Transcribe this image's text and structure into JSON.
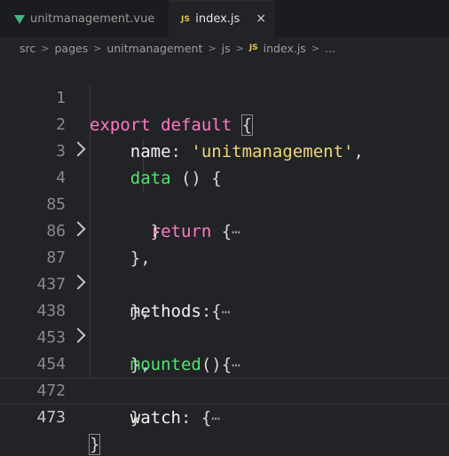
{
  "tabs": [
    {
      "label": "unitmanagement.vue",
      "icon": "vue-icon",
      "active": false
    },
    {
      "label": "index.js",
      "icon": "js-icon",
      "icon_text": "JS",
      "active": true,
      "close": "×"
    }
  ],
  "breadcrumb": {
    "items": [
      "src",
      "pages",
      "unitmanagement",
      "js"
    ],
    "file_icon_text": "JS",
    "file": "index.js",
    "more": "...",
    "separator": ">"
  },
  "editor": {
    "lines": [
      {
        "num": "1",
        "folded": false
      },
      {
        "num": "2",
        "folded": false
      },
      {
        "num": "3",
        "folded": false
      },
      {
        "num": "4",
        "folded": true
      },
      {
        "num": "85",
        "folded": false
      },
      {
        "num": "86",
        "folded": false
      },
      {
        "num": "87",
        "folded": true
      },
      {
        "num": "437",
        "folded": false
      },
      {
        "num": "438",
        "folded": true
      },
      {
        "num": "453",
        "folded": false
      },
      {
        "num": "454",
        "folded": true
      },
      {
        "num": "472",
        "folded": false
      },
      {
        "num": "473",
        "folded": false
      }
    ],
    "code": {
      "export": "export",
      "default": "default",
      "open_brace": "{",
      "name_key": "name",
      "name_value": "'unitmanagement'",
      "data_fn": "data",
      "return_kw": "return",
      "methods_key": "methods",
      "mounted_fn": "mounted",
      "watch_key": "watch",
      "ellipsis": "⋯"
    }
  },
  "colors": {
    "keyword": "#ff79c6",
    "function": "#50e36f",
    "string": "#f1d676",
    "vue": "#41b883",
    "js": "#e3c44c"
  }
}
